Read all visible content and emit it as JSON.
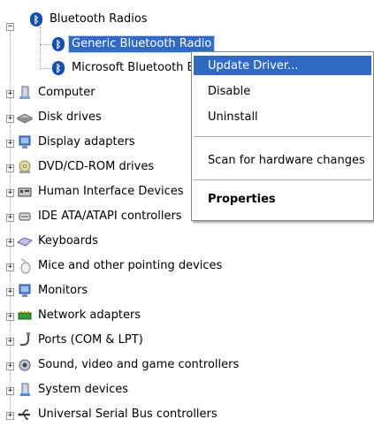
{
  "tree": {
    "root_category": {
      "label": "Bluetooth Radios",
      "icon": "bluetooth-icon",
      "expanded": true
    },
    "children": [
      {
        "label": "Generic Bluetooth Radio",
        "icon": "bluetooth-icon",
        "selected": true
      },
      {
        "label": "Microsoft Bluetooth Er",
        "icon": "bluetooth-icon",
        "selected": false
      }
    ],
    "categories": [
      {
        "label": "Computer",
        "icon": "computer-icon"
      },
      {
        "label": "Disk drives",
        "icon": "disk-drive-icon"
      },
      {
        "label": "Display adapters",
        "icon": "display-adapter-icon"
      },
      {
        "label": "DVD/CD-ROM drives",
        "icon": "dvd-drive-icon"
      },
      {
        "label": "Human Interface Devices",
        "icon": "hid-icon"
      },
      {
        "label": "IDE ATA/ATAPI controllers",
        "icon": "ide-controller-icon"
      },
      {
        "label": "Keyboards",
        "icon": "keyboard-icon"
      },
      {
        "label": "Mice and other pointing devices",
        "icon": "mouse-icon"
      },
      {
        "label": "Monitors",
        "icon": "monitor-icon"
      },
      {
        "label": "Network adapters",
        "icon": "network-adapter-icon"
      },
      {
        "label": "Ports (COM & LPT)",
        "icon": "port-icon"
      },
      {
        "label": "Sound, video and game controllers",
        "icon": "sound-icon"
      },
      {
        "label": "System devices",
        "icon": "system-device-icon"
      },
      {
        "label": "Universal Serial Bus controllers",
        "icon": "usb-icon"
      }
    ]
  },
  "context_menu": {
    "items": [
      {
        "label": "Update Driver...",
        "highlighted": true,
        "bold": false
      },
      {
        "label": "Disable",
        "highlighted": false,
        "bold": false
      },
      {
        "label": "Uninstall",
        "highlighted": false,
        "bold": false
      },
      {
        "label": "Scan for hardware changes",
        "highlighted": false,
        "bold": false
      },
      {
        "label": "Properties",
        "highlighted": false,
        "bold": true
      }
    ]
  },
  "colors": {
    "selection": "#316ac5",
    "bluetooth": "#1450a8",
    "background": "#ffffff"
  }
}
